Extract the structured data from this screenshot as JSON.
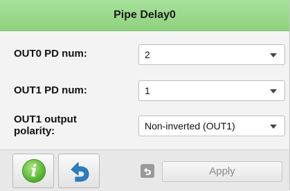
{
  "panel": {
    "title": "Pipe Delay0"
  },
  "fields": [
    {
      "label": "OUT0 PD num:",
      "value": "2"
    },
    {
      "label": "OUT1 PD num:",
      "value": "1"
    },
    {
      "label_line1": "OUT1 output",
      "label_line2": "polarity:",
      "value": "Non-inverted (OUT1)"
    }
  ],
  "footer": {
    "info_icon": "info-icon",
    "undo_icon": "undo-arrow-icon",
    "apply_label": "Apply"
  },
  "colors": {
    "header": "#8fd27f",
    "info": "#4fae2a",
    "undo": "#2a7fc4"
  }
}
